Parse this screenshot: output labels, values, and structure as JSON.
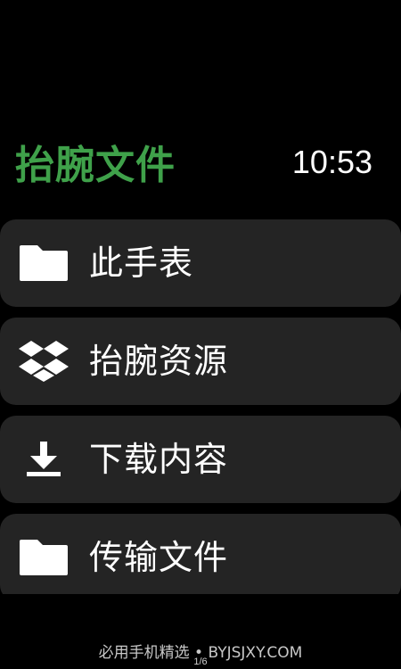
{
  "header": {
    "title": "抬腕文件",
    "time": "10:53"
  },
  "colors": {
    "accent": "#3fa14a",
    "background": "#000000",
    "item_background": "#242424",
    "text": "#ffffff"
  },
  "menu": {
    "items": [
      {
        "label": "此手表",
        "icon": "folder-icon"
      },
      {
        "label": "抬腕资源",
        "icon": "dropbox-icon"
      },
      {
        "label": "下载内容",
        "icon": "download-icon"
      },
      {
        "label": "传输文件",
        "icon": "folder-icon"
      }
    ]
  },
  "footer": {
    "watermark": "必用手机精选 • BYJSJXY.COM",
    "page_indicator": "1/6"
  }
}
